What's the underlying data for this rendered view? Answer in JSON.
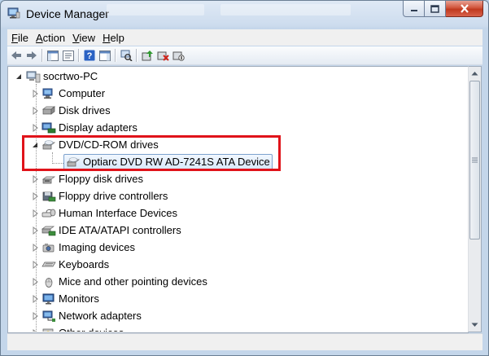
{
  "window": {
    "title": "Device Manager"
  },
  "menu": [
    {
      "accel": "F",
      "rest": "ile"
    },
    {
      "accel": "A",
      "rest": "ction"
    },
    {
      "accel": "V",
      "rest": "iew"
    },
    {
      "accel": "H",
      "rest": "elp"
    }
  ],
  "toolbar": {
    "buttons": [
      "back-icon",
      "forward-icon",
      "show-hide-console-tree-icon",
      "properties-icon",
      "help-icon",
      "action-pane-icon",
      "scan-hardware-icon",
      "update-driver-icon",
      "uninstall-icon",
      "disable-icon"
    ]
  },
  "tree": {
    "root": "socrtwo-PC",
    "nodes": [
      {
        "label": "Computer",
        "icon": "computer-icon",
        "expanded": false
      },
      {
        "label": "Disk drives",
        "icon": "disk-drive-icon",
        "expanded": false
      },
      {
        "label": "Display adapters",
        "icon": "display-adapter-icon",
        "expanded": false
      },
      {
        "label": "DVD/CD-ROM drives",
        "icon": "dvd-drive-icon",
        "expanded": true
      },
      {
        "label": "Optiarc DVD RW AD-7241S ATA Device",
        "icon": "dvd-drive-icon",
        "child": true,
        "selected": true
      },
      {
        "label": "Floppy disk drives",
        "icon": "floppy-disk-icon",
        "expanded": false
      },
      {
        "label": "Floppy drive controllers",
        "icon": "floppy-controller-icon",
        "expanded": false
      },
      {
        "label": "Human Interface Devices",
        "icon": "hid-icon",
        "expanded": false
      },
      {
        "label": "IDE ATA/ATAPI controllers",
        "icon": "ide-controller-icon",
        "expanded": false
      },
      {
        "label": "Imaging devices",
        "icon": "imaging-device-icon",
        "expanded": false
      },
      {
        "label": "Keyboards",
        "icon": "keyboard-icon",
        "expanded": false
      },
      {
        "label": "Mice and other pointing devices",
        "icon": "mouse-icon",
        "expanded": false
      },
      {
        "label": "Monitors",
        "icon": "monitor-icon",
        "expanded": false
      },
      {
        "label": "Network adapters",
        "icon": "network-adapter-icon",
        "expanded": false
      },
      {
        "label": "Other devices",
        "icon": "other-devices-icon",
        "expanded": false
      }
    ]
  },
  "colors": {
    "highlight_border": "#e0131a",
    "selection_border": "#7da2ce"
  }
}
